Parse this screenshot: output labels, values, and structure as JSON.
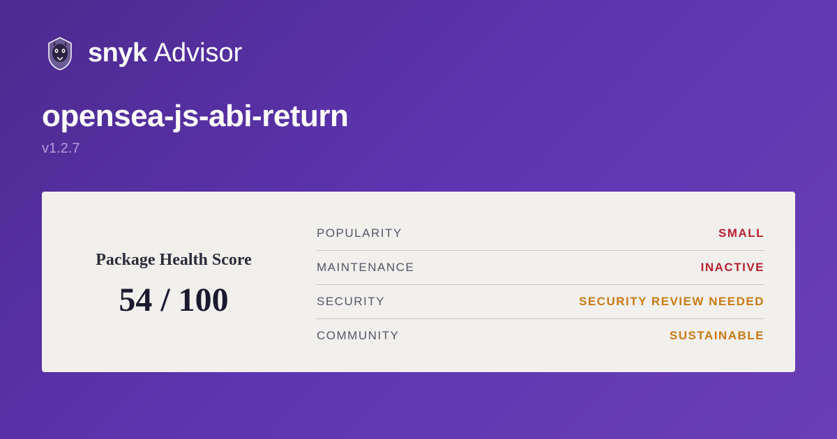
{
  "brand": {
    "bold": "snyk",
    "light": "Advisor"
  },
  "package": {
    "name": "opensea-js-abi-return",
    "version": "v1.2.7"
  },
  "score": {
    "label": "Package Health Score",
    "value": "54 / 100"
  },
  "metrics": [
    {
      "label": "POPULARITY",
      "value": "SMALL",
      "cls": "val-red"
    },
    {
      "label": "MAINTENANCE",
      "value": "INACTIVE",
      "cls": "val-red"
    },
    {
      "label": "SECURITY",
      "value": "SECURITY REVIEW NEEDED",
      "cls": "val-orange"
    },
    {
      "label": "COMMUNITY",
      "value": "SUSTAINABLE",
      "cls": "val-orange"
    }
  ]
}
